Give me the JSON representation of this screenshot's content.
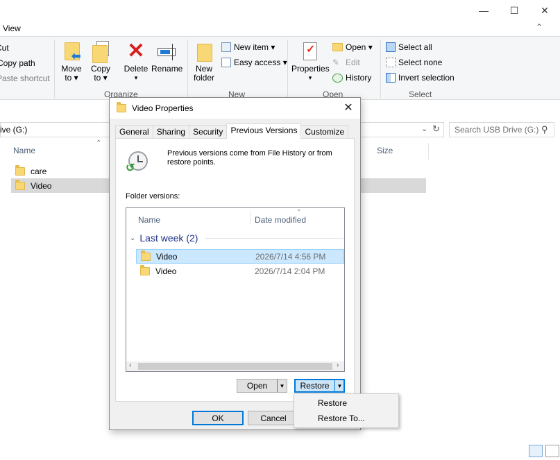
{
  "explorer": {
    "ribbon_tab_view": "View",
    "clipboard": {
      "cut": "Cut",
      "copy_path": "Copy path",
      "paste_shortcut": "Paste shortcut"
    },
    "organize": {
      "move_to_l1": "Move",
      "move_to_l2": "to ▾",
      "copy_to_l1": "Copy",
      "copy_to_l2": "to ▾",
      "delete": "Delete",
      "delete_arrow": "▾",
      "rename": "Rename",
      "label": "Organize"
    },
    "new": {
      "new_folder_l1": "New",
      "new_folder_l2": "folder",
      "new_item": "New item ▾",
      "easy_access": "Easy access ▾",
      "label": "New"
    },
    "open_group": {
      "properties": "Properties",
      "properties_arrow": "▾",
      "open": "Open ▾",
      "edit": "Edit",
      "history": "History",
      "label": "Open"
    },
    "select": {
      "select_all": "Select all",
      "select_none": "Select none",
      "invert_selection": "Invert selection",
      "label": "Select"
    },
    "address": "ive (G:)",
    "search_placeholder": "Search USB Drive (G:)",
    "columns": {
      "name": "Name",
      "size": "Size"
    },
    "files": [
      {
        "name": "care"
      },
      {
        "name": "Video"
      }
    ]
  },
  "dialog": {
    "title": "Video Properties",
    "tabs": [
      "General",
      "Sharing",
      "Security",
      "Previous Versions",
      "Customize"
    ],
    "info_text": "Previous versions come from File History or from restore points.",
    "folder_versions_label": "Folder versions:",
    "list": {
      "col_name": "Name",
      "col_date": "Date modified",
      "group_label": "Last week (2)",
      "rows": [
        {
          "name": "Video",
          "date": "2026/7/14   4:56 PM"
        },
        {
          "name": "Video",
          "date": "2026/7/14   2:04 PM"
        }
      ]
    },
    "open_button": "Open",
    "restore_button": "Restore",
    "ok_button": "OK",
    "cancel_button": "Cancel"
  },
  "restore_menu": {
    "items": [
      "Restore",
      "Restore To..."
    ]
  },
  "colors": {
    "selection": "#cce8ff",
    "accent": "#0078d7",
    "group_header": "#1e3287"
  }
}
